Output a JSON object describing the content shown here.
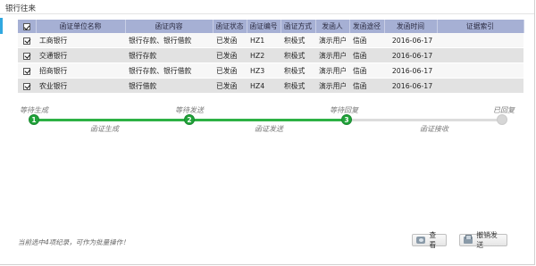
{
  "panel": {
    "title": "银行往来"
  },
  "table": {
    "headers": {
      "unit": "函证单位名称",
      "content": "函证内容",
      "status": "函证状态",
      "number": "函证编号",
      "method": "函证方式",
      "sender": "发函人",
      "channel": "发函途径",
      "time": "发函时间",
      "index": "证据索引"
    },
    "rows": [
      {
        "unit": "工商银行",
        "content": "银行存款、银行借款",
        "status": "已发函",
        "number": "HZ1",
        "method": "积极式",
        "sender": "演示用户",
        "channel": "信函",
        "time": "2016-06-17",
        "index": ""
      },
      {
        "unit": "交通银行",
        "content": "银行存款",
        "status": "已发函",
        "number": "HZ2",
        "method": "积极式",
        "sender": "演示用户",
        "channel": "信函",
        "time": "2016-06-17",
        "index": ""
      },
      {
        "unit": "招商银行",
        "content": "银行存款、银行借款",
        "status": "已发函",
        "number": "HZ3",
        "method": "积极式",
        "sender": "演示用户",
        "channel": "信函",
        "time": "2016-06-17",
        "index": ""
      },
      {
        "unit": "农业银行",
        "content": "银行借款",
        "status": "已发函",
        "number": "HZ4",
        "method": "积极式",
        "sender": "演示用户",
        "channel": "信函",
        "time": "2016-06-17",
        "index": ""
      }
    ]
  },
  "steps": {
    "nodes": [
      {
        "num": "1",
        "label": "等待生成",
        "state": "done"
      },
      {
        "num": "2",
        "label": "等待发送",
        "state": "done"
      },
      {
        "num": "3",
        "label": "等待回复",
        "state": "done"
      },
      {
        "num": "",
        "label": "已回复",
        "state": "pending"
      }
    ],
    "edges": [
      {
        "label": "函证生成"
      },
      {
        "label": "函证发送"
      },
      {
        "label": "函证接收"
      }
    ],
    "colors": {
      "done": "#21a33a",
      "pending": "#d6d6d6"
    }
  },
  "footer": {
    "note": "当前选中4项纪录，可作为批量操作！",
    "view_label": "查看",
    "revoke_label": "撤销发送"
  },
  "colors": {
    "header_bg": "#a6b0d4",
    "accent": "#31a8e0"
  },
  "icons": {
    "view": "view-icon",
    "revoke": "revoke-icon"
  }
}
